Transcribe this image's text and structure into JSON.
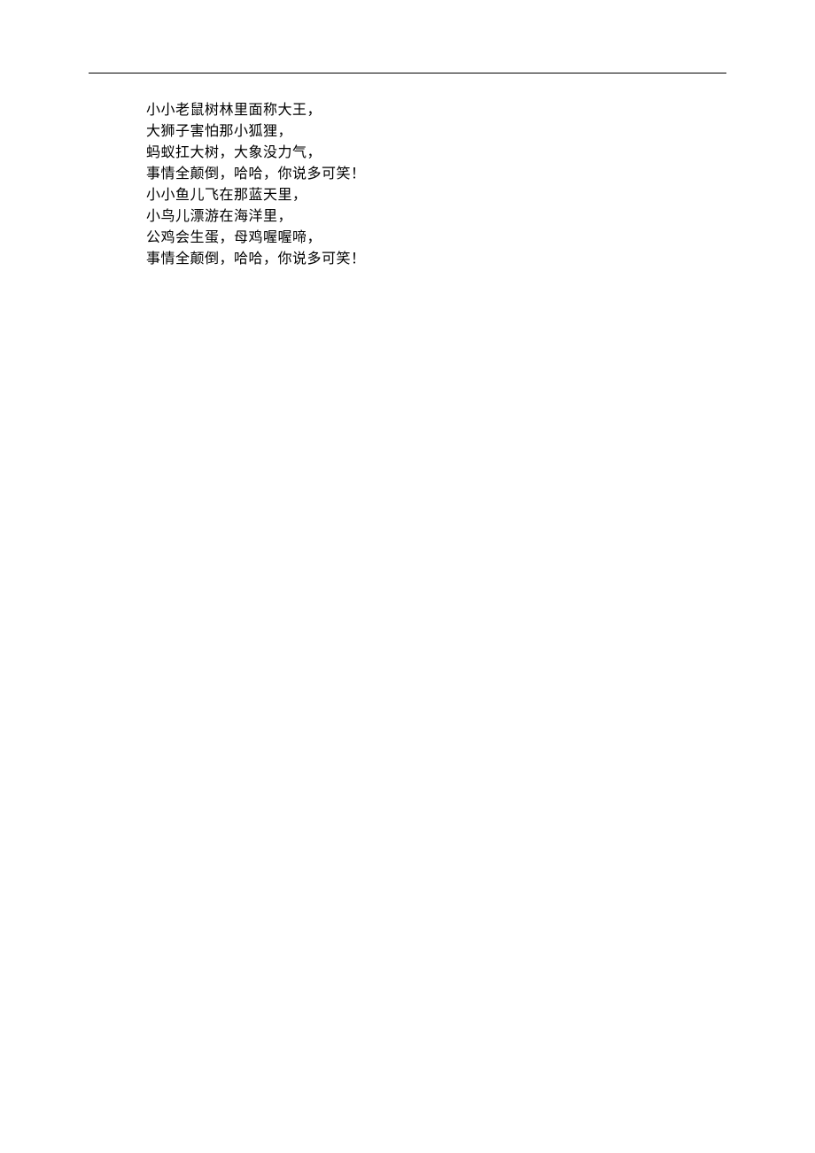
{
  "poem": {
    "lines": [
      "小小老鼠树林里面称大王，",
      "大狮子害怕那小狐狸，",
      "蚂蚁扛大树，大象没力气，",
      "事情全颠倒，哈哈，你说多可笑！",
      "小小鱼儿飞在那蓝天里，",
      "小鸟儿漂游在海洋里，",
      "公鸡会生蛋，母鸡喔喔啼，",
      "事情全颠倒，哈哈，你说多可笑！"
    ]
  }
}
